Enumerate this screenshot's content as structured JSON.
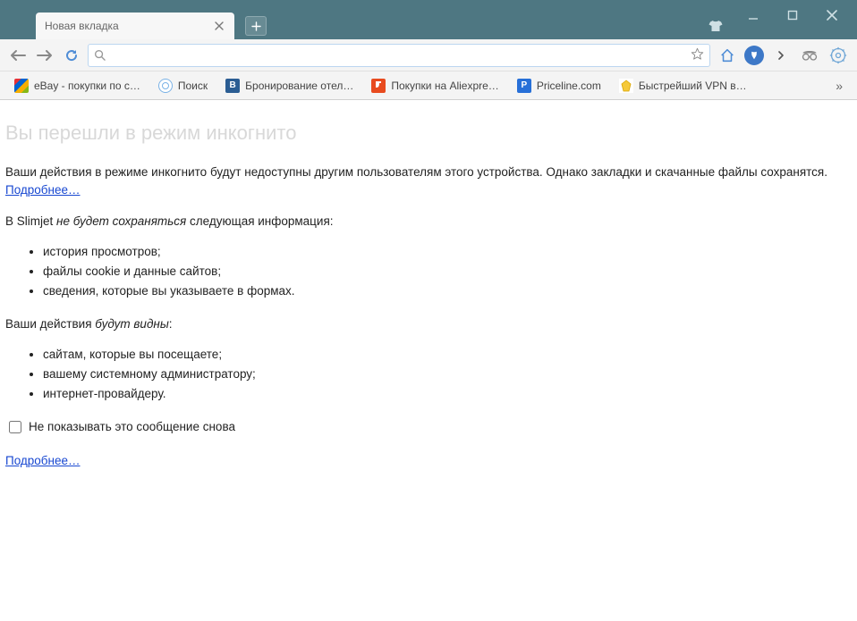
{
  "tab": {
    "title": "Новая вкладка"
  },
  "urlbar": {
    "value": ""
  },
  "bookmarks": {
    "items": [
      {
        "label": "eBay - покупки по с…"
      },
      {
        "label": "Поиск"
      },
      {
        "label": "Бронирование отел…"
      },
      {
        "label": "Покупки на Aliexpre…"
      },
      {
        "label": "Priceline.com"
      },
      {
        "label": "Быстрейший VPN в …"
      }
    ]
  },
  "content": {
    "heading": "Вы перешли в режим инкогнито",
    "intro_a": "Ваши действия в режиме инкогнито будут недоступны другим пользователям этого устройства. Однако закладки и скачанные файлы сохранятся. ",
    "learn_more": "Подробнее…",
    "not_saved_prefix": "В Slimjet ",
    "not_saved_em": "не будет сохраняться",
    "not_saved_suffix": " следующая информация:",
    "not_saved_items": [
      "история просмотров;",
      "файлы cookie и данные сайтов;",
      "сведения, которые вы указываете в формах."
    ],
    "visible_prefix": "Ваши действия ",
    "visible_em": "будут видны",
    "visible_suffix": ":",
    "visible_items": [
      "сайтам, которые вы посещаете;",
      "вашему системному администратору;",
      "интернет-провайдеру."
    ],
    "checkbox_label": "Не показывать это сообщение снова",
    "bottom_link": "Подробнее…"
  }
}
